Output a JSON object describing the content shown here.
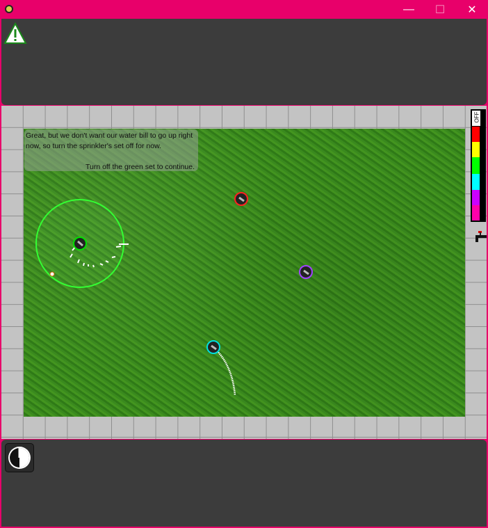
{
  "window": {
    "minimize_glyph": "—",
    "maximize_glyph": "☐",
    "close_glyph": "✕"
  },
  "top_panel": {
    "alert_icon": "warning-icon"
  },
  "message": {
    "line1": "Great, but we don't want our water bill to go up right now, so turn the sprinkler's set off for now.",
    "line2": "Turn off the green set to continue."
  },
  "color_selector": {
    "off_label": "OFF",
    "swatches": [
      "#ff0000",
      "#ffff00",
      "#00ff00",
      "#00ffff",
      "#cc00ff",
      "#ff00aa"
    ]
  },
  "sprinklers": [
    {
      "color": "#00e000",
      "set": "green",
      "spraying": true
    },
    {
      "color": "#ff2020",
      "set": "red",
      "spraying": false
    },
    {
      "color": "#a040ff",
      "set": "purple",
      "spraying": false
    },
    {
      "color": "#00e0e0",
      "set": "cyan",
      "spraying": true
    }
  ],
  "bottom_panel": {
    "power_icon": "power-dial-icon"
  }
}
